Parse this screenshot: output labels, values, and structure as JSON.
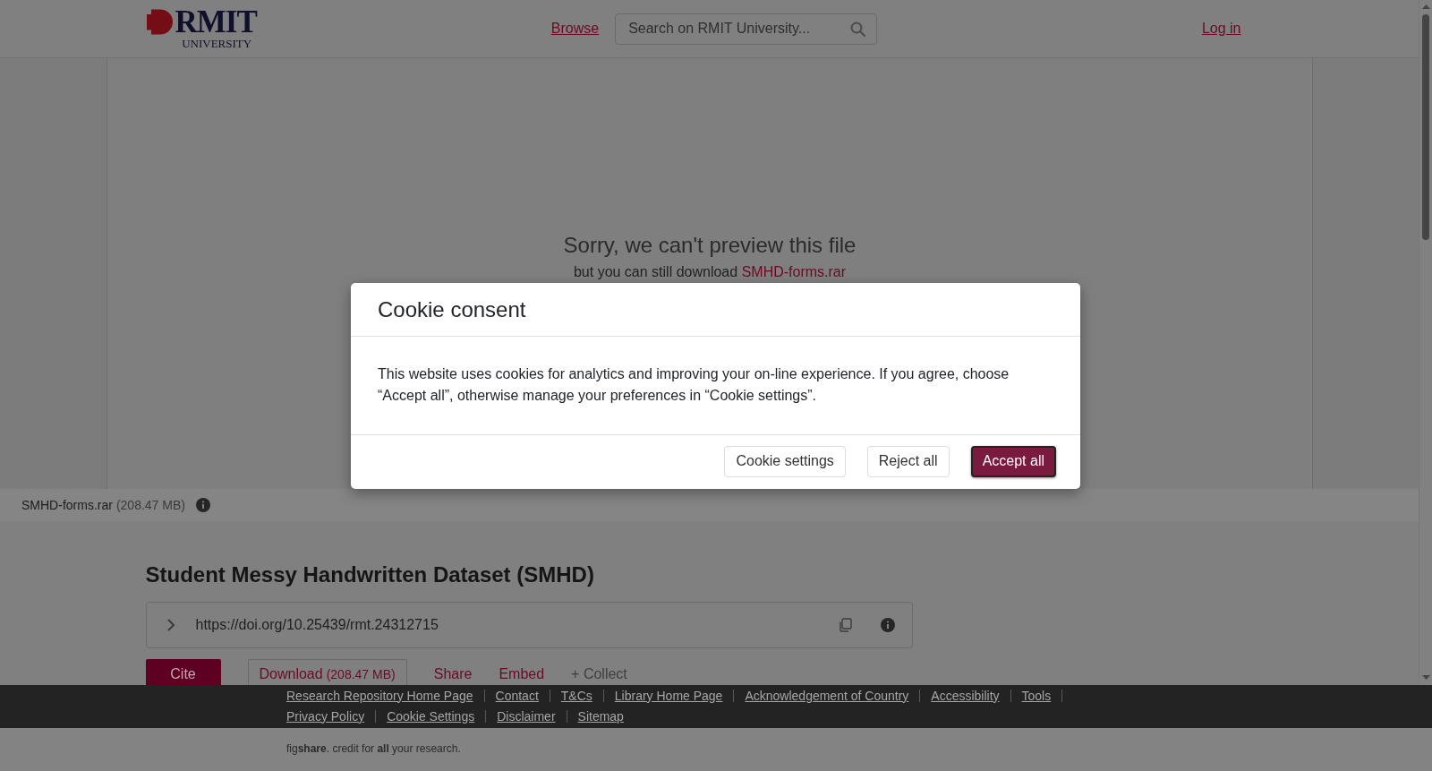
{
  "header": {
    "logo": {
      "wordmark": "RMIT",
      "subtitle": "UNIVERSITY"
    },
    "browse_link": "Browse",
    "search": {
      "placeholder": "Search on RMIT University..."
    },
    "login_link": "Log in"
  },
  "preview": {
    "message": "Sorry, we can't preview this file",
    "note": "but you can still download",
    "file_link": "SMHD-forms.rar"
  },
  "file_bar": {
    "name": "SMHD-forms.rar",
    "size": "(208.47 MB)"
  },
  "item": {
    "title": "Student Messy Handwritten Dataset (SMHD)",
    "doi": "https://doi.org/10.25439/rmt.24312715",
    "actions": [
      {
        "kind": "primary",
        "label": "Cite"
      },
      {
        "kind": "download",
        "label": "Download",
        "size": "(208.47 MB)"
      },
      {
        "kind": "link",
        "label": "Share"
      },
      {
        "kind": "link",
        "label": "Embed"
      },
      {
        "kind": "muted",
        "label": "+ Collect"
      }
    ]
  },
  "footer": {
    "link_rows": [
      [
        "Research Repository Home Page",
        "Contact",
        "T&Cs",
        "Library Home Page",
        "Acknowledgement of Country",
        "Accessibility",
        "Tools"
      ],
      [
        "Privacy Policy",
        "Cookie Settings",
        "Disclaimer",
        "Sitemap"
      ]
    ],
    "tagline": "fig**share**. credit for **all** your research."
  },
  "cookie_dialog": {
    "title": "Cookie consent",
    "body": "This website uses cookies for analytics and improving your on-line experience. If you agree, choose “Accept all”, otherwise manage your preferences in “Cookie settings”.",
    "buttons": [
      {
        "kind": "secondary",
        "label": "Cookie settings",
        "focused": false
      },
      {
        "kind": "secondary",
        "label": "Reject all",
        "focused": false
      },
      {
        "kind": "primary",
        "label": "Accept all",
        "focused": true
      }
    ]
  }
}
